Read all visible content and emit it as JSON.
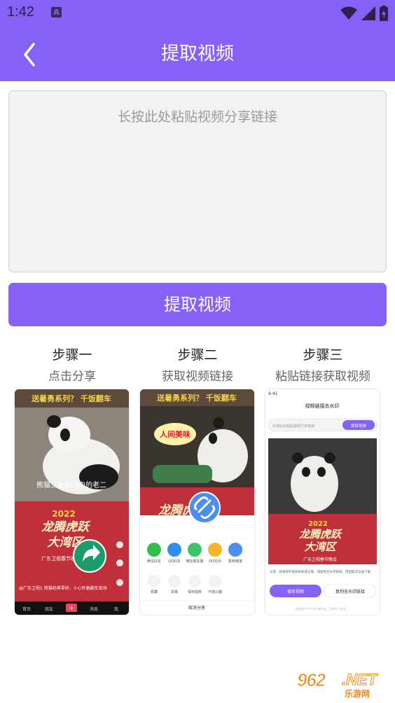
{
  "status_bar": {
    "time": "1:42",
    "notification_icon": "A"
  },
  "header": {
    "title": "提取视频",
    "back_icon": "chevron-left-icon"
  },
  "input": {
    "placeholder": "长按此处粘贴视频分享链接",
    "value": ""
  },
  "extract_button": {
    "label": "提取视频"
  },
  "steps": [
    {
      "title": "步骤一",
      "desc": "点击分享"
    },
    {
      "title": "步骤二",
      "desc": "获取视频链接"
    },
    {
      "title": "步骤三",
      "desc": "粘贴链接获取视频"
    }
  ],
  "step1_shot": {
    "banner": "送暑勇系列？ 千饭翻车",
    "caption": "熊猫三胞胎当中的老二",
    "poster_year": "2022",
    "poster_line1": "龙腾虎跃",
    "poster_line2": "大湾区",
    "poster_channel": "广东卫视春节晚会",
    "author_line": "@广东卫视1  熊猫经典零碎，小心吵着翻车现场",
    "nav": [
      "首页",
      "朋友",
      "+",
      "消息",
      "我"
    ]
  },
  "step2_shot": {
    "banner": "送暑勇系列？ 千饭翻车",
    "bubble": "人间美味",
    "poster_line1": "龙腾虎跃",
    "share_row1": [
      "微信好友",
      "QQ好友",
      "微信朋友圈",
      "QQ空间",
      "复制链接"
    ],
    "share_row2": [
      "收藏",
      "举报",
      "保存视频",
      "不感兴趣"
    ],
    "cancel": "取消分享"
  },
  "step3_shot": {
    "time": "9:41",
    "title": "视频链接去水印",
    "input_placeholder": "长按此处粘贴视频分享链接",
    "extract_label": "提取视频",
    "poster_year": "2022",
    "poster_line1": "龙腾虎跃",
    "poster_line2": "大湾区",
    "poster_channel": "广东卫视春节晚会",
    "note": "注意：如果保存视频失败或太慢，请复制无水印链接，用电脑浏览器下载",
    "save_label": "保存视频",
    "copy_label": "复制无水印链接",
    "footer": "视频图片归平台作者所有，仅供学习参考。"
  },
  "watermark": {
    "number": "962",
    "suffix": ".NET",
    "site": "乐游网"
  },
  "colors": {
    "accent": "#8562f5",
    "input_bg": "#f2f2f2",
    "poster_red": "#c0303a"
  }
}
